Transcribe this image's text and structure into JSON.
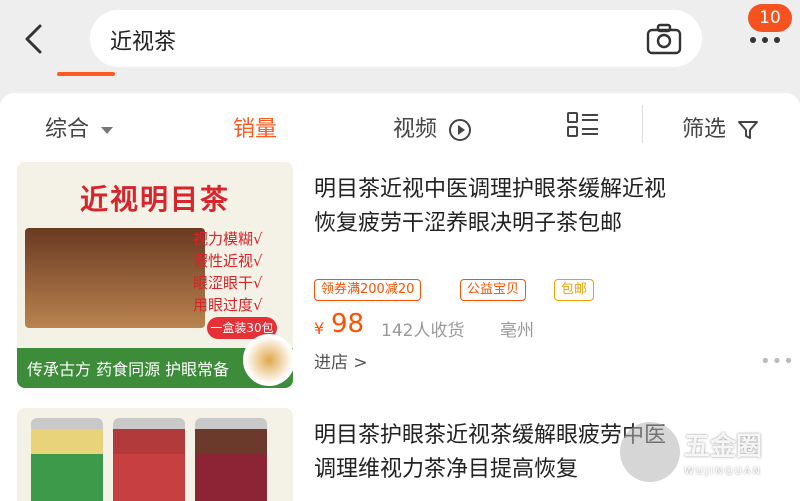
{
  "search": {
    "query": "近视茶"
  },
  "header": {
    "badge_count": "10"
  },
  "filters": [
    {
      "label": "综合",
      "active": false
    },
    {
      "label": "销量",
      "active": true
    },
    {
      "label": "视频",
      "active": false
    },
    {
      "label": "筛选",
      "active": false
    }
  ],
  "products": [
    {
      "title_line1": "明目茶近视中医调理护眼茶缓解近视",
      "title_line2": "恢复疲劳干涩养眼决明子茶包邮",
      "tags": [
        {
          "text": "领券满200减20",
          "color": "#ff5000"
        },
        {
          "text": "公益宝贝",
          "color": "#ff5000"
        },
        {
          "text": "包邮",
          "color": "#f2a000"
        }
      ],
      "price_symbol": "¥",
      "price": "98",
      "sold": "142人收货",
      "location": "亳州",
      "store_link": "进店 >",
      "image": {
        "title": "近视明目茶",
        "claims": [
          "视力模糊√",
          "假性近视√",
          "眼涩眼干√",
          "用眼过度√"
        ],
        "pill": "一盒装30包",
        "slogan": "传承古方  药食同源  护眼常备"
      }
    },
    {
      "title_line1": "明目茶护眼茶近视茶缓解眼疲劳中医",
      "title_line2": "调理维视力茶净目提高恢复"
    }
  ],
  "watermark": {
    "title": "五金圈",
    "sub": "WUJINQUAN"
  }
}
